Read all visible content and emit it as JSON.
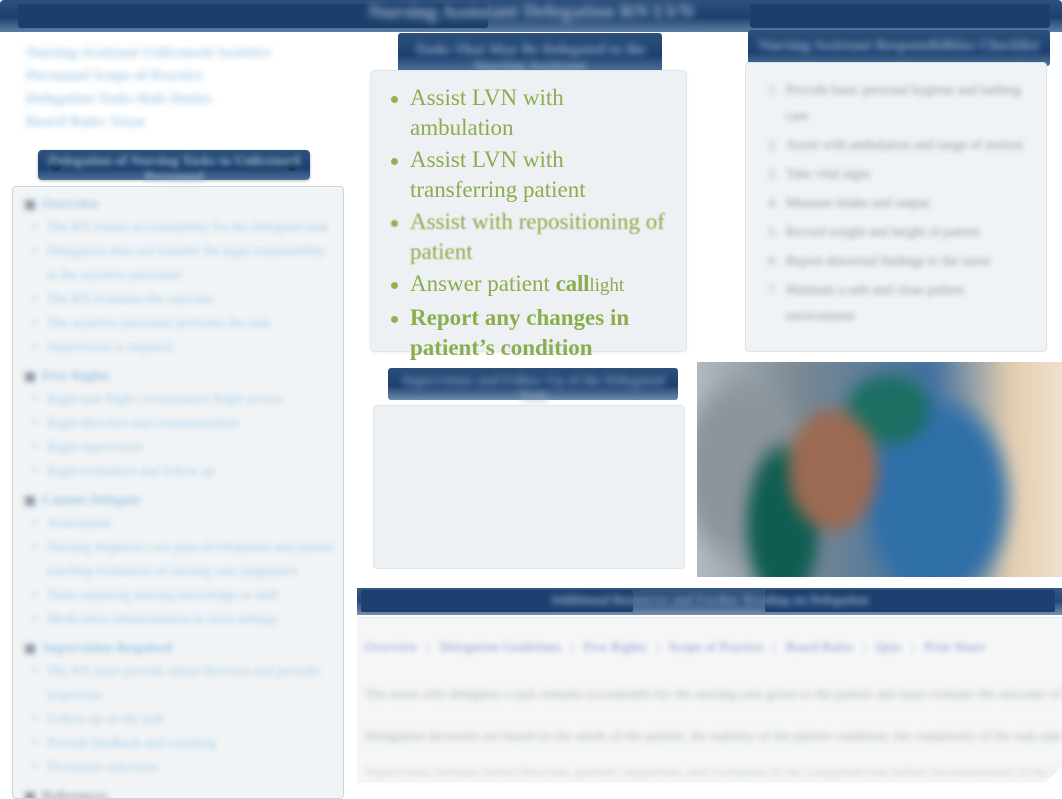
{
  "slide": {
    "banner_title": "Nursing Assistant Delegation  RN  LVN"
  },
  "left": {
    "heading_lines": [
      "Nursing Assistant Unlicensed Assistive",
      "Personnel  Scope  of  Practice",
      "Delegation  Tasks  Role  Duties",
      "Board  Rules  Texas"
    ],
    "panel_header": "Delegation of Nursing Tasks to Unlicensed Personnel",
    "groups": [
      {
        "title": "Overview",
        "items": [
          "The RN retains accountability for the delegated task",
          "Delegation does not transfer the legal responsibility to the assistive personnel",
          "The RN evaluates the outcome",
          "The assistive personnel performs the task",
          "Supervision is required"
        ]
      },
      {
        "title": "Five Rights",
        "items": [
          "Right task  Right circumstance  Right person",
          "Right direction and communication",
          "Right supervision",
          "Right evaluation and follow up"
        ]
      },
      {
        "title": "Cannot Delegate",
        "items": [
          "Assessment",
          "Nursing diagnosis  care plan development and patient teaching  evaluation of nursing care  judgement",
          "Tasks requiring nursing knowledge or skill",
          "Medication administration in most settings"
        ]
      },
      {
        "title": "Supervision Required",
        "items": [
          "The RN must provide initial direction and periodic inspection",
          "Follow up on the task",
          "Provide feedback and coaching",
          "Document outcomes"
        ]
      }
    ],
    "footer_note": "References"
  },
  "center": {
    "top_header": "Tasks That May Be Delegated to the Nursing Assistant",
    "bullets": [
      {
        "text": "Assist LVN with ambulation"
      },
      {
        "text": "Assist LVN with transferring patient"
      },
      {
        "text": "Assist with repositioning of patient"
      },
      {
        "text": "Answer patient ",
        "emph": "call",
        "tail": "light"
      },
      {
        "text": "Report any changes in patient’s condition"
      }
    ],
    "mid_header": "Supervision and Follow Up of the Delegated Task"
  },
  "right": {
    "top_header": "Nursing Assistant Responsibilities Checklist",
    "items": [
      "Provide basic personal hygiene and bathing care",
      "Assist with ambulation and range of motion",
      "Take vital signs",
      "Measure intake and output",
      "Record weight and height of patient",
      "Report abnormal findings to the nurse",
      "Maintain a safe and clean patient environment"
    ]
  },
  "bottom": {
    "header": "Additional Resources and Further Reading on Delegation",
    "links": [
      "Overview",
      "Delegation Guidelines",
      "Five Rights",
      "Scope of Practice",
      "Board Rules",
      "Quiz",
      "Print  Share"
    ],
    "paragraphs": [
      "The nurse who delegates a task remains accountable for the nursing care given to the patient and must evaluate the outcome of that task.",
      "Delegation decisions are based on the needs of the patient, the stability of the patient condition, the complexity of the task and the training of the assistive personnel.",
      "Supervision includes initial direction, periodic inspection, and evaluation of the completed task before documentation of the care provided."
    ]
  },
  "icons": {
    "bullet": "bullet-dot-icon",
    "square_bullet": "square-bullet-icon",
    "panel_dot": "panel-dot-icon"
  },
  "colors": {
    "navy": "#1c4070",
    "navy_light": "#5d7ea4",
    "green": "#8aad4e",
    "panel_bg": "#eef1f3",
    "sidebar_text": "#aacde9",
    "link": "#8b8fd0"
  }
}
